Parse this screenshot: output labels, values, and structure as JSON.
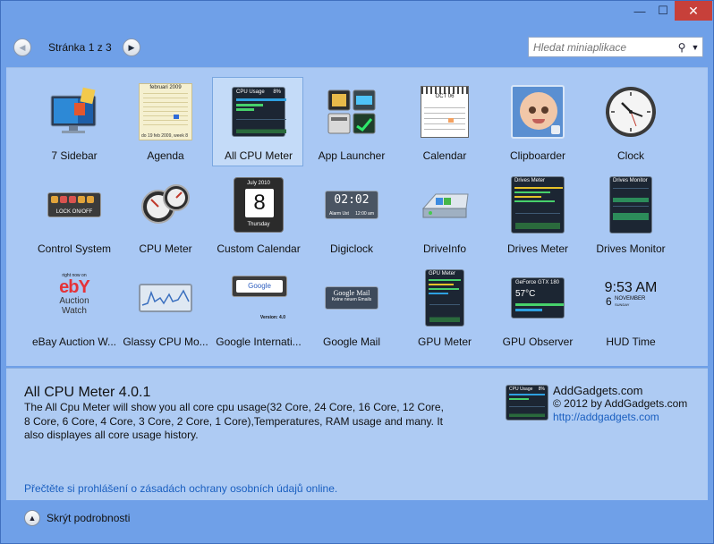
{
  "window": {
    "minimize": "—",
    "maximize": "☐",
    "close": "✕"
  },
  "toolbar": {
    "page_label": "Stránka 1 z 3",
    "prev_icon": "◀",
    "next_icon": "▶",
    "search_placeholder": "Hledat miniaplikace",
    "search_icon": "⚲",
    "search_dropdown_icon": "▼"
  },
  "gadgets": [
    {
      "label": "7 Sidebar",
      "selected": false
    },
    {
      "label": "Agenda",
      "selected": false
    },
    {
      "label": "All CPU Meter",
      "selected": true
    },
    {
      "label": "App Launcher",
      "selected": false
    },
    {
      "label": "Calendar",
      "selected": false
    },
    {
      "label": "Clipboarder",
      "selected": false
    },
    {
      "label": "Clock",
      "selected": false
    },
    {
      "label": "Control System",
      "selected": false
    },
    {
      "label": "CPU Meter",
      "selected": false
    },
    {
      "label": "Custom Calendar",
      "selected": false
    },
    {
      "label": "Digiclock",
      "selected": false
    },
    {
      "label": "DriveInfo",
      "selected": false
    },
    {
      "label": "Drives Meter",
      "selected": false
    },
    {
      "label": "Drives Monitor",
      "selected": false
    },
    {
      "label": "eBay Auction W...",
      "selected": false
    },
    {
      "label": "Glassy CPU Mo...",
      "selected": false
    },
    {
      "label": "Google Internati...",
      "selected": false
    },
    {
      "label": "Google Mail",
      "selected": false
    },
    {
      "label": "GPU Meter",
      "selected": false
    },
    {
      "label": "GPU Observer",
      "selected": false
    },
    {
      "label": "HUD Time",
      "selected": false
    }
  ],
  "thumb_text": {
    "agenda_month": "februari 2009",
    "agenda_footer": "do 19 feb 2009, week 8",
    "cpu_usage_title": "CPU Usage",
    "cpu_usage_pct": "8%",
    "calendar_month": "OCT 06",
    "control_system": "LOCK ON/OFF",
    "custom_cal_month": "July 2010",
    "custom_cal_day": "8",
    "custom_cal_weekday": "Thursday",
    "digiclock_time": "02:02",
    "digiclock_sub": "Alarm Ust",
    "digiclock_ampm": "12:00 am",
    "drives_meter_title": "Drives Meter",
    "drives_monitor_title": "Drives Monitor",
    "ebay_top": "right now on",
    "ebay_logo": "ebY",
    "ebay_bottom": "Auction Watch",
    "google_version": "Version: 4.0",
    "google_mail_title": "Google Mail",
    "google_mail_sub": "Keine neuen Emails",
    "gpu_meter_title": "GPU Meter",
    "gpu_observer_title": "GeForce GTX 180",
    "gpu_observer_temp": "57°C",
    "hud_time": "9:53 AM",
    "hud_day": "6",
    "hud_month": "NOVEMBER",
    "hud_weekday": "SUNDAY"
  },
  "details": {
    "title": "All CPU Meter 4.0.1",
    "description": "The All Cpu Meter will show you all core cpu usage(32 Core, 24 Core, 16 Core, 12 Core, 8 Core, 6 Core, 4 Core, 3 Core, 2 Core, 1 Core),Temperatures, RAM usage and many. It also displayes all core usage history.",
    "author": "AddGadgets.com",
    "copyright": "© 2012 by AddGadgets.com",
    "website": "http://addgadgets.com",
    "privacy_link": "Přečtěte si prohlášení o zásadách ochrany osobních údajů online."
  },
  "footer": {
    "hide_icon": "▲",
    "hide_label": "Skrýt podrobnosti"
  },
  "colors": {
    "window_bg": "#6fa0e8",
    "gallery_bg": "#a9c8f4",
    "selected_tile": "#c4dbf8",
    "link": "#1a5fc0",
    "close_button": "#c7403a"
  }
}
